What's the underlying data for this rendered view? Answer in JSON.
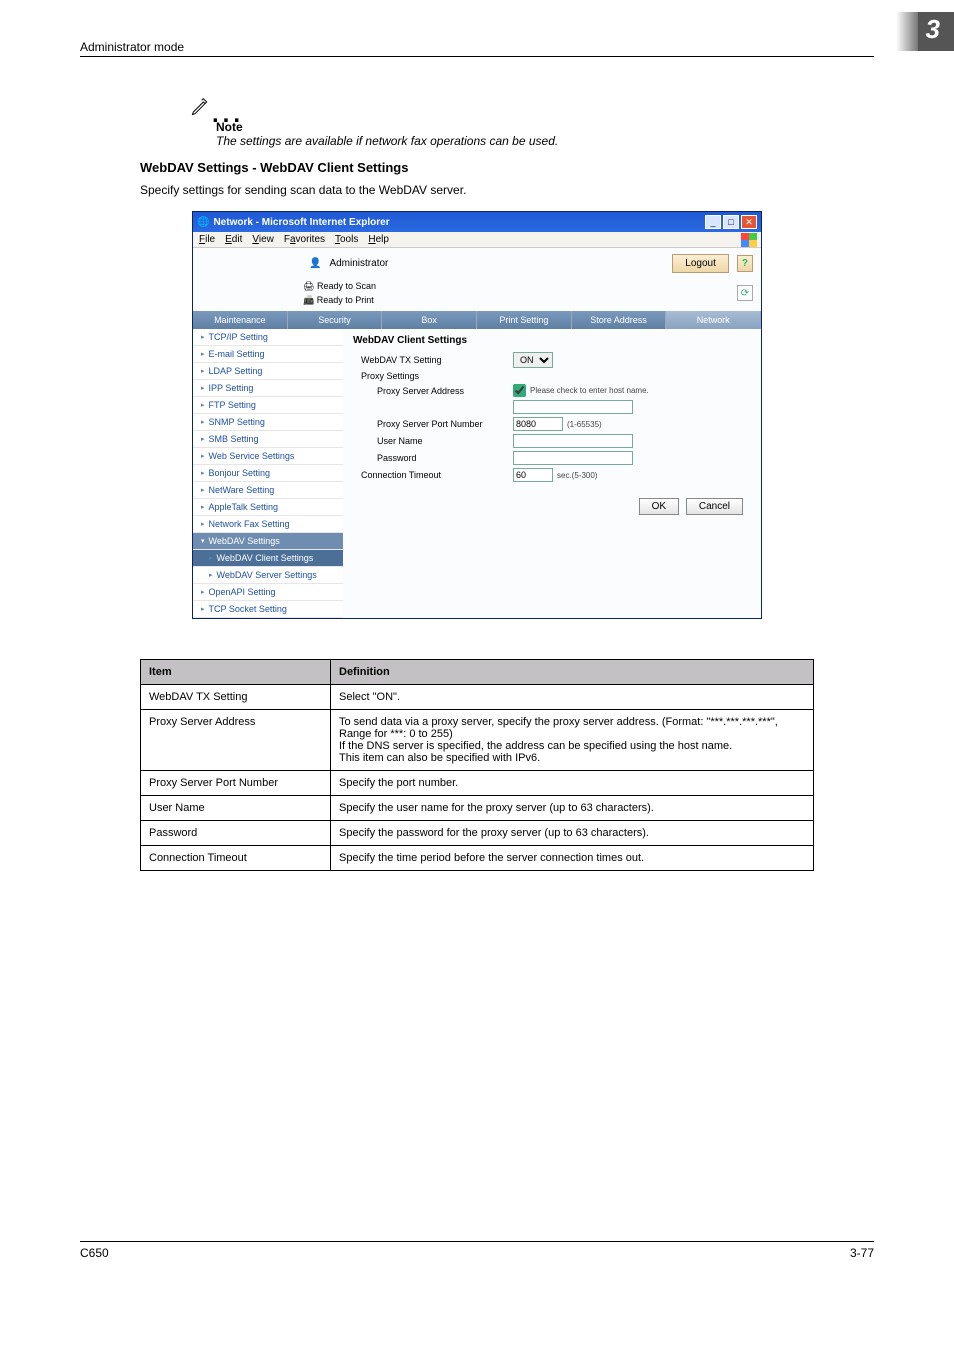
{
  "header": {
    "mode": "Administrator mode",
    "chapnum": "3"
  },
  "note": {
    "head": "Note",
    "body": "The settings are available if network fax operations can be used."
  },
  "section": {
    "title": "WebDAV Settings - WebDAV Client Settings",
    "desc": "Specify settings for sending scan data to the WebDAV server."
  },
  "ie": {
    "title": "Network - Microsoft Internet Explorer",
    "menu": [
      "File",
      "Edit",
      "View",
      "Favorites",
      "Tools",
      "Help"
    ],
    "admin": "Administrator",
    "logout": "Logout",
    "status1": "Ready to Scan",
    "status2": "Ready to Print",
    "tabs": [
      "Maintenance",
      "Security",
      "Box",
      "Print Setting",
      "Store Address",
      "Network"
    ],
    "side": [
      "TCP/IP Setting",
      "E-mail Setting",
      "LDAP Setting",
      "IPP Setting",
      "FTP Setting",
      "SNMP Setting",
      "SMB Setting",
      "Web Service Settings",
      "Bonjour Setting",
      "NetWare Setting",
      "AppleTalk Setting",
      "Network Fax Setting"
    ],
    "side_exp": "WebDAV Settings",
    "side_sub1": "WebDAV Client Settings",
    "side_sub2": "WebDAV Server Settings",
    "side_after": [
      "OpenAPI Setting",
      "TCP Socket Setting"
    ],
    "panel_title": "WebDAV Client Settings",
    "f_tx": "WebDAV TX Setting",
    "f_tx_val": "ON",
    "f_proxy_group": "Proxy Settings",
    "f_proxy_addr": "Proxy Server Address",
    "f_proxy_addr_chk": "Please check to enter host name.",
    "f_port": "Proxy Server Port Number",
    "f_port_val": "8080",
    "f_port_hint": "(1-65535)",
    "f_user": "User Name",
    "f_pass": "Password",
    "f_timeout": "Connection Timeout",
    "f_timeout_val": "60",
    "f_timeout_hint": "sec.(5-300)",
    "btn_ok": "OK",
    "btn_cancel": "Cancel"
  },
  "table": {
    "head_item": "Item",
    "head_def": "Definition",
    "rows": [
      {
        "item": "WebDAV TX Setting",
        "def": "Select \"ON\"."
      },
      {
        "item": "Proxy Server Address",
        "def": "To send data via a proxy server, specify the proxy server address. (Format: \"***.***.***.***\", Range for ***: 0 to 255)\nIf the DNS server is specified, the address can be specified using the host name.\nThis item can also be specified with IPv6."
      },
      {
        "item": "Proxy Server Port Number",
        "def": "Specify the port number."
      },
      {
        "item": "User Name",
        "def": "Specify the user name for the proxy server (up to 63 characters)."
      },
      {
        "item": "Password",
        "def": "Specify the password for the proxy server (up to 63 characters)."
      },
      {
        "item": "Connection Timeout",
        "def": "Specify the time period before the server connection times out."
      }
    ]
  },
  "footer": {
    "left": "C650",
    "right": "3-77"
  }
}
